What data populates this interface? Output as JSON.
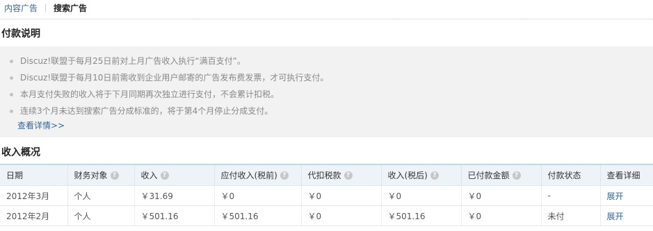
{
  "tabs": {
    "content_ads": "内容广告",
    "search_ads": "搜索广告"
  },
  "payment_notes": {
    "title": "付款说明",
    "items": [
      "Discuz!联盟于每月25日前对上月广告收入执行“满百支付”。",
      "Discuz!联盟于每月10日前需收到企业用户邮寄的广告发布费发票，才可执行支付。",
      "本月支付失败的收入将于下月同期再次独立进行支付，不会累计扣税。",
      "连续3个月未达到搜索广告分成标准的，将于第4个月停止分成支付。"
    ],
    "more_link": "查看详情>>"
  },
  "income": {
    "title": "收入概况",
    "help_icon": "?",
    "columns": {
      "date": "日期",
      "object": "财务对象",
      "income": "收入",
      "payable": "应付收入(税前)",
      "tax": "代扣税款",
      "after_tax": "收入(税后)",
      "paid": "已付款金额",
      "status": "付款状态",
      "detail": "查看详细"
    },
    "rows": [
      {
        "date": "2012年3月",
        "object": "个人",
        "income": "￥31.69",
        "payable": "￥0",
        "tax": "￥0",
        "after_tax": "￥0",
        "paid": "￥0",
        "status": "-",
        "detail": "展开"
      },
      {
        "date": "2012年2月",
        "object": "个人",
        "income": "￥501.16",
        "payable": "￥501.16",
        "tax": "￥0",
        "after_tax": "￥501.16",
        "paid": "￥0",
        "status": "未付",
        "detail": "展开"
      }
    ]
  },
  "colors": {
    "link": "#336699",
    "notes_background": "#f2f2f2",
    "table_header_background": "#eef3f8"
  }
}
